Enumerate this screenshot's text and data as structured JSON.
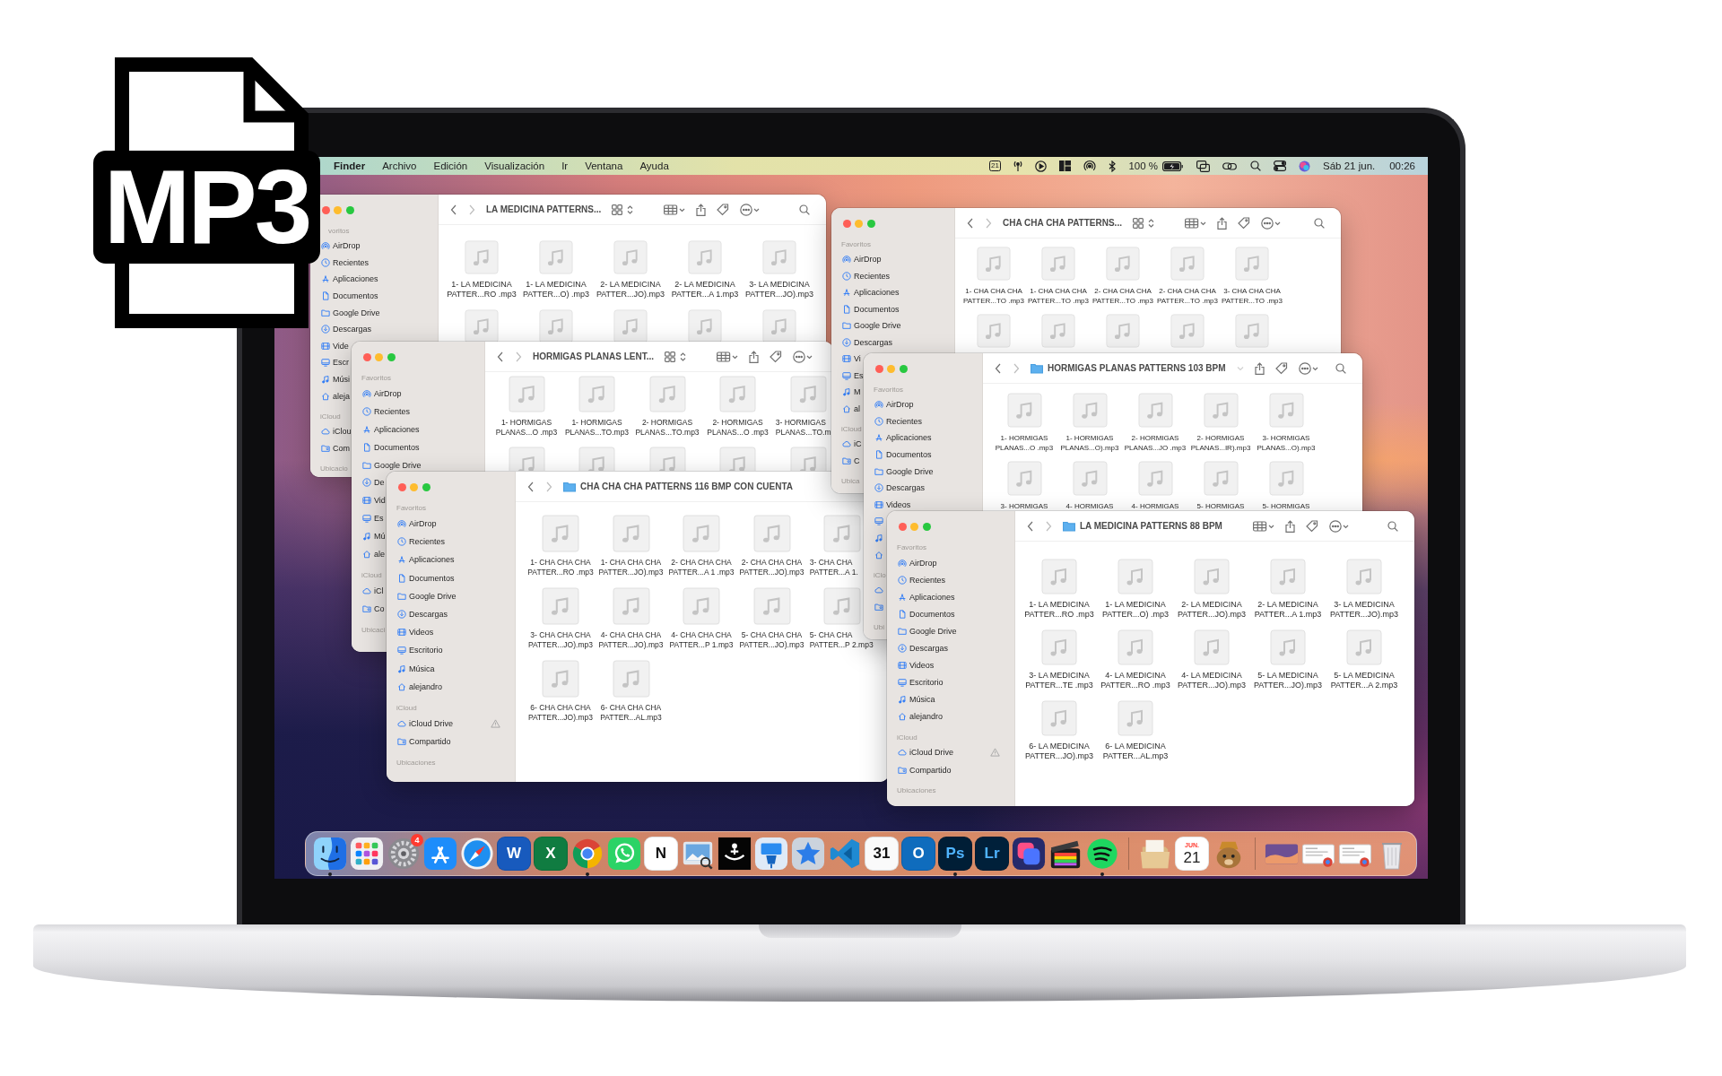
{
  "file_icon": {
    "label": "MP3"
  },
  "menu_bar": {
    "menus": [
      {
        "label": "Finder",
        "kind": "app"
      },
      {
        "label": "Archivo",
        "kind": "menu"
      },
      {
        "label": "Edición",
        "kind": "menu"
      },
      {
        "label": "Visualización",
        "kind": "menu"
      },
      {
        "label": "Ir",
        "kind": "menu"
      },
      {
        "label": "Ventana",
        "kind": "menu"
      },
      {
        "label": "Ayuda",
        "kind": "menu"
      }
    ],
    "status": [
      {
        "kind": "calendar",
        "text": "21"
      },
      {
        "kind": "antenna"
      },
      {
        "kind": "play"
      },
      {
        "kind": "layout"
      },
      {
        "kind": "airdrop"
      },
      {
        "kind": "bluetooth"
      },
      {
        "kind": "percent",
        "text": "100 %"
      },
      {
        "kind": "battery"
      },
      {
        "kind": "mirror"
      },
      {
        "kind": "link"
      },
      {
        "kind": "search"
      },
      {
        "kind": "control"
      },
      {
        "kind": "siri"
      },
      {
        "kind": "date",
        "text": "Sáb 21 jun."
      },
      {
        "kind": "time",
        "text": "00:26"
      }
    ]
  },
  "windows": [
    {
      "title": "LA MEDICINA PATTERNS...",
      "tools": [
        {
          "kind": "back"
        },
        {
          "kind": "forward"
        },
        {
          "kind": "title"
        },
        {
          "kind": "view"
        },
        {
          "kind": "group"
        },
        {
          "kind": "share"
        },
        {
          "kind": "tag"
        },
        {
          "kind": "more"
        },
        {
          "kind": "search"
        }
      ],
      "sections": [
        {
          "title": "voritos",
          "items": [
            {
              "label": "AirDrop",
              "kind": "airdrop"
            },
            {
              "label": "Recientes",
              "kind": "clock"
            },
            {
              "label": "Aplicaciones",
              "kind": "apps"
            },
            {
              "label": "Documentos",
              "kind": "document"
            },
            {
              "label": "Google Drive",
              "kind": "folder"
            },
            {
              "label": "Descargas",
              "kind": "download"
            },
            {
              "label": "Vide",
              "kind": "film"
            },
            {
              "label": "Escr",
              "kind": "monitor"
            },
            {
              "label": "Músi",
              "kind": "music"
            },
            {
              "label": "aleja",
              "kind": "home"
            }
          ]
        },
        {
          "title": "iCloud",
          "items": [
            {
              "label": "iClou",
              "kind": "cloud"
            },
            {
              "label": "Com",
              "kind": "shared-folder"
            }
          ]
        },
        {
          "title": "Ubicacio"
        }
      ],
      "files": [
        {
          "kind": "file",
          "lines": [
            "1- LA MEDICINA",
            "PATTER...RO .mp3"
          ]
        },
        {
          "kind": "file",
          "lines": [
            "1- LA MEDICINA",
            "PATTER...O) .mp3"
          ]
        },
        {
          "kind": "file",
          "lines": [
            "2- LA MEDICINA",
            "PATTER...JO).mp3"
          ]
        },
        {
          "kind": "file",
          "lines": [
            "2- LA MEDICINA",
            "PATTER...A 1.mp3"
          ]
        },
        {
          "kind": "file",
          "lines": [
            "3- LA MEDICINA",
            "PATTER...JO).mp3"
          ]
        },
        {
          "kind": "icon"
        },
        {
          "kind": "icon"
        },
        {
          "kind": "icon"
        },
        {
          "kind": "icon"
        },
        {
          "kind": "icon"
        }
      ]
    },
    {
      "title": "HORMIGAS PLANAS LENT...",
      "tools": [
        {
          "kind": "back"
        },
        {
          "kind": "forward"
        },
        {
          "kind": "title"
        },
        {
          "kind": "view"
        },
        {
          "kind": "group"
        },
        {
          "kind": "share"
        },
        {
          "kind": "tag"
        },
        {
          "kind": "more"
        }
      ],
      "sections": [
        {
          "title": "Favoritos",
          "items": [
            {
              "label": "AirDrop",
              "kind": "airdrop"
            },
            {
              "label": "Recientes",
              "kind": "clock"
            },
            {
              "label": "Aplicaciones",
              "kind": "apps"
            },
            {
              "label": "Documentos",
              "kind": "document"
            },
            {
              "label": "Google Drive",
              "kind": "folder"
            },
            {
              "label": "De",
              "kind": "download"
            },
            {
              "label": "Vid",
              "kind": "film"
            },
            {
              "label": "Es",
              "kind": "monitor"
            },
            {
              "label": "Mú",
              "kind": "music"
            },
            {
              "label": "ale",
              "kind": "home"
            }
          ]
        },
        {
          "title": "iCloud",
          "items": [
            {
              "label": "iCl",
              "kind": "cloud"
            },
            {
              "label": "Co",
              "kind": "shared-folder"
            }
          ]
        },
        {
          "title": "Ubicaci"
        }
      ],
      "files": [
        {
          "kind": "file",
          "lines": [
            "1- HORMIGAS",
            "PLANAS...O .mp3"
          ]
        },
        {
          "kind": "file",
          "lines": [
            "1- HORMIGAS",
            "PLANAS...TO.mp3"
          ]
        },
        {
          "kind": "file",
          "lines": [
            "2- HORMIGAS",
            "PLANAS...TO.mp3"
          ]
        },
        {
          "kind": "file",
          "lines": [
            "2- HORMIGAS",
            "PLANAS...O .mp3"
          ]
        },
        {
          "kind": "clipped",
          "lines": [
            "3- HORMIGAS",
            "PLANAS...TO.m"
          ]
        },
        {
          "kind": "icon"
        },
        {
          "kind": "icon"
        },
        {
          "kind": "icon"
        },
        {
          "kind": "icon"
        },
        {
          "kind": "icon"
        }
      ]
    },
    {
      "title": "CHA CHA CHA PATTERNS 116 BMP CON CUENTA",
      "tools": [
        {
          "kind": "back"
        },
        {
          "kind": "forward"
        },
        {
          "kind": "folder"
        },
        {
          "kind": "title"
        }
      ],
      "sections": [
        {
          "title": "Favoritos",
          "items": [
            {
              "label": "AirDrop",
              "kind": "airdrop"
            },
            {
              "label": "Recientes",
              "kind": "clock"
            },
            {
              "label": "Aplicaciones",
              "kind": "apps"
            },
            {
              "label": "Documentos",
              "kind": "document"
            },
            {
              "label": "Google Drive",
              "kind": "folder"
            },
            {
              "label": "Descargas",
              "kind": "download"
            },
            {
              "label": "Videos",
              "kind": "film"
            },
            {
              "label": "Escritorio",
              "kind": "monitor"
            },
            {
              "label": "Música",
              "kind": "music"
            },
            {
              "label": "alejandro",
              "kind": "home"
            }
          ]
        },
        {
          "title": "iCloud",
          "items": [
            {
              "label": "iCloud Drive",
              "kind": "cloud",
              "warning": true
            },
            {
              "label": "Compartido",
              "kind": "shared-folder",
              "warning": false
            }
          ]
        },
        {
          "title": "Ubicaciones"
        }
      ],
      "files": [
        {
          "kind": "file",
          "lines": [
            "1- CHA CHA CHA",
            "PATTER...RO .mp3"
          ]
        },
        {
          "kind": "file",
          "lines": [
            "1- CHA CHA CHA",
            "PATTER...JO).mp3"
          ]
        },
        {
          "kind": "file",
          "lines": [
            "2- CHA CHA CHA",
            "PATTER...A 1 .mp3"
          ]
        },
        {
          "kind": "file",
          "lines": [
            "2- CHA CHA CHA",
            "PATTER...JO).mp3"
          ]
        },
        {
          "kind": "clipped",
          "lines": [
            "3- CHA CHA",
            "PATTER...A 1."
          ]
        },
        {
          "kind": "file",
          "lines": [
            "3- CHA CHA CHA",
            "PATTER...JO).mp3"
          ]
        },
        {
          "kind": "file",
          "lines": [
            "4- CHA CHA CHA",
            "PATTER...JO).mp3"
          ]
        },
        {
          "kind": "file",
          "lines": [
            "4- CHA CHA CHA",
            "PATTER...P 1.mp3"
          ]
        },
        {
          "kind": "file",
          "lines": [
            "5- CHA CHA CHA",
            "PATTER...JO).mp3"
          ]
        },
        {
          "kind": "clipped",
          "lines": [
            "5- CHA CHA",
            "PATTER...P 2.mp3"
          ]
        },
        {
          "kind": "file",
          "lines": [
            "6- CHA CHA CHA",
            "PATTER...JO).mp3"
          ]
        },
        {
          "kind": "file",
          "lines": [
            "6- CHA CHA CHA",
            "PATTER...AL.mp3"
          ]
        }
      ]
    },
    {
      "title": "CHA CHA CHA PATTERNS...",
      "tools": [
        {
          "kind": "back"
        },
        {
          "kind": "forward"
        },
        {
          "kind": "title"
        },
        {
          "kind": "view"
        },
        {
          "kind": "group"
        },
        {
          "kind": "share"
        },
        {
          "kind": "tag"
        },
        {
          "kind": "more"
        },
        {
          "kind": "search"
        }
      ],
      "sections": [
        {
          "title": "Favoritos",
          "items": [
            {
              "label": "AirDrop",
              "kind": "airdrop"
            },
            {
              "label": "Recientes",
              "kind": "clock"
            },
            {
              "label": "Aplicaciones",
              "kind": "apps"
            },
            {
              "label": "Documentos",
              "kind": "document"
            },
            {
              "label": "Google Drive",
              "kind": "folder"
            },
            {
              "label": "Descargas",
              "kind": "download"
            },
            {
              "label": "Vi",
              "kind": "film"
            },
            {
              "label": "Es",
              "kind": "monitor"
            },
            {
              "label": "M",
              "kind": "music"
            },
            {
              "label": "al",
              "kind": "home"
            }
          ]
        },
        {
          "title": "iCloud",
          "items": [
            {
              "label": "iC",
              "kind": "cloud"
            },
            {
              "label": "C",
              "kind": "shared-folder"
            }
          ]
        },
        {
          "title": "Ubica"
        }
      ],
      "files": [
        {
          "kind": "file",
          "lines": [
            "1- CHA CHA CHA",
            "PATTER...TO .mp3"
          ]
        },
        {
          "kind": "file",
          "lines": [
            "1- CHA CHA CHA",
            "PATTER...TO .mp3"
          ]
        },
        {
          "kind": "file",
          "lines": [
            "2- CHA CHA CHA",
            "PATTER...TO .mp3"
          ]
        },
        {
          "kind": "file",
          "lines": [
            "2- CHA CHA CHA",
            "PATTER...TO .mp3"
          ]
        },
        {
          "kind": "file",
          "lines": [
            "3- CHA CHA CHA",
            "PATTER...TO .mp3"
          ]
        },
        {
          "kind": "icon"
        },
        {
          "kind": "icon"
        },
        {
          "kind": "icon"
        },
        {
          "kind": "icon"
        },
        {
          "kind": "icon"
        }
      ]
    },
    {
      "title": "HORMIGAS PLANAS PATTERNS 103 BPM",
      "tools": [
        {
          "kind": "back"
        },
        {
          "kind": "forward"
        },
        {
          "kind": "folder"
        },
        {
          "kind": "title"
        },
        {
          "kind": "chevron"
        },
        {
          "kind": "share"
        },
        {
          "kind": "tag"
        },
        {
          "kind": "more"
        },
        {
          "kind": "search"
        }
      ],
      "sections": [
        {
          "title": "Favoritos",
          "items": [
            {
              "label": "AirDrop",
              "kind": "airdrop"
            },
            {
              "label": "Recientes",
              "kind": "clock"
            },
            {
              "label": "Aplicaciones",
              "kind": "apps"
            },
            {
              "label": "Documentos",
              "kind": "document"
            },
            {
              "label": "Google Drive",
              "kind": "folder"
            },
            {
              "label": "Descargas",
              "kind": "download"
            },
            {
              "label": "Videos",
              "kind": "film"
            },
            {
              "kind": "monitor"
            },
            {
              "kind": "music"
            },
            {
              "kind": "home"
            }
          ]
        },
        {
          "title": "iClo",
          "items": [
            {
              "kind": "cloud"
            },
            {
              "kind": "shared-folder"
            }
          ]
        },
        {
          "title": "Ubi"
        }
      ],
      "files": [
        {
          "kind": "file",
          "lines": [
            "1- HORMIGAS",
            "PLANAS...O .mp3"
          ]
        },
        {
          "kind": "file",
          "lines": [
            "1- HORMIGAS",
            "PLANAS...O).mp3"
          ]
        },
        {
          "kind": "file",
          "lines": [
            "2- HORMIGAS",
            "PLANAS...JO .mp3"
          ]
        },
        {
          "kind": "file",
          "lines": [
            "2- HORMIGAS",
            "PLANAS...IR).mp3"
          ]
        },
        {
          "kind": "file",
          "lines": [
            "3- HORMIGAS",
            "PLANAS...O).mp3"
          ]
        },
        {
          "kind": "file",
          "lines": [
            "3- HORMIGAS"
          ]
        },
        {
          "kind": "file",
          "lines": [
            "4- HORMIGAS"
          ]
        },
        {
          "kind": "file",
          "lines": [
            "4- HORMIGAS"
          ]
        },
        {
          "kind": "file",
          "lines": [
            "5- HORMIGAS"
          ]
        },
        {
          "kind": "file",
          "lines": [
            "5- HORMIGAS"
          ]
        }
      ]
    },
    {
      "title": "LA MEDICINA PATTERNS 88 BPM",
      "tools": [
        {
          "kind": "back"
        },
        {
          "kind": "forward"
        },
        {
          "kind": "folder"
        },
        {
          "kind": "title"
        },
        {
          "kind": "group"
        },
        {
          "kind": "share"
        },
        {
          "kind": "tag"
        },
        {
          "kind": "more"
        },
        {
          "kind": "search"
        }
      ],
      "sections": [
        {
          "title": "Favoritos",
          "items": [
            {
              "label": "AirDrop",
              "kind": "airdrop"
            },
            {
              "label": "Recientes",
              "kind": "clock"
            },
            {
              "label": "Aplicaciones",
              "kind": "apps"
            },
            {
              "label": "Documentos",
              "kind": "document"
            },
            {
              "label": "Google Drive",
              "kind": "folder"
            },
            {
              "label": "Descargas",
              "kind": "download"
            },
            {
              "label": "Videos",
              "kind": "film"
            },
            {
              "label": "Escritorio",
              "kind": "monitor"
            },
            {
              "label": "Música",
              "kind": "music"
            },
            {
              "label": "alejandro",
              "kind": "home"
            }
          ]
        },
        {
          "title": "iCloud",
          "items": [
            {
              "label": "iCloud Drive",
              "kind": "cloud",
              "warning": true
            },
            {
              "label": "Compartido",
              "kind": "shared-folder",
              "warning": false
            }
          ]
        },
        {
          "title": "Ubicaciones"
        }
      ],
      "files": [
        {
          "kind": "file",
          "lines": [
            "1- LA MEDICINA",
            "PATTER...RO .mp3"
          ]
        },
        {
          "kind": "file",
          "lines": [
            "1- LA MEDICINA",
            "PATTER...O) .mp3"
          ]
        },
        {
          "kind": "file",
          "lines": [
            "2- LA MEDICINA",
            "PATTER...JO).mp3"
          ]
        },
        {
          "kind": "file",
          "lines": [
            "2- LA MEDICINA",
            "PATTER...A 1.mp3"
          ]
        },
        {
          "kind": "file",
          "lines": [
            "3- LA MEDICINA",
            "PATTER...JO).mp3"
          ]
        },
        {
          "kind": "file",
          "lines": [
            "3- LA MEDICINA",
            "PATTER...TE .mp3"
          ]
        },
        {
          "kind": "file",
          "lines": [
            "4- LA MEDICINA",
            "PATTER...RO .mp3"
          ]
        },
        {
          "kind": "file",
          "lines": [
            "4- LA MEDICINA",
            "PATTER...JO).mp3"
          ]
        },
        {
          "kind": "file",
          "lines": [
            "5- LA MEDICINA",
            "PATTER...JO).mp3"
          ]
        },
        {
          "kind": "file",
          "lines": [
            "5- LA MEDICINA",
            "PATTER...A 2.mp3"
          ]
        },
        {
          "kind": "file",
          "lines": [
            "6- LA MEDICINA",
            "PATTER...JO).mp3"
          ]
        },
        {
          "kind": "file",
          "lines": [
            "6- LA MEDICINA",
            "PATTER...AL.mp3"
          ]
        }
      ]
    }
  ],
  "dock": {
    "groups": [
      {
        "items": [
          {
            "kind": "finder",
            "running": true
          },
          {
            "kind": "launchpad",
            "running": false
          },
          {
            "kind": "settings",
            "badge": "4",
            "running": false
          },
          {
            "kind": "appstore",
            "running": false
          },
          {
            "kind": "safari",
            "running": false
          },
          {
            "kind": "letter",
            "label": "W",
            "color": "#185abd",
            "running": false
          },
          {
            "kind": "letter",
            "label": "X",
            "color": "#107c41",
            "running": false
          },
          {
            "kind": "chrome",
            "running": true
          },
          {
            "kind": "whatsapp",
            "running": false
          },
          {
            "kind": "letter",
            "label": "N",
            "color": "#ffffff",
            "running": false
          },
          {
            "kind": "preview",
            "running": false
          },
          {
            "kind": "hammock",
            "running": false
          },
          {
            "kind": "keynote",
            "running": false
          },
          {
            "kind": "star",
            "running": false
          },
          {
            "kind": "vscode",
            "running": false
          },
          {
            "kind": "letter",
            "label": "31",
            "color": "#fafafa",
            "running": false
          },
          {
            "kind": "letter",
            "label": "O",
            "color": "#0f6cbd",
            "running": false
          },
          {
            "kind": "letter",
            "label": "Ps",
            "color": "#001e36",
            "running": true
          },
          {
            "kind": "letter",
            "label": "Lr",
            "color": "#00203a",
            "running": false
          },
          {
            "kind": "shortcuts",
            "running": false
          },
          {
            "kind": "finalcut",
            "running": false
          },
          {
            "kind": "spotify",
            "running": true
          }
        ]
      },
      {
        "items": [
          {
            "kind": "stack",
            "running": false
          },
          {
            "kind": "calendar",
            "month": "JUN.",
            "day": "21",
            "running": false
          },
          {
            "kind": "bear",
            "running": false
          }
        ]
      },
      {
        "items": [
          {
            "kind": "photo-thumb",
            "running": false
          },
          {
            "kind": "window-thumb",
            "running": false
          },
          {
            "kind": "window-thumb",
            "running": false
          },
          {
            "kind": "trash",
            "running": false
          }
        ]
      }
    ]
  }
}
